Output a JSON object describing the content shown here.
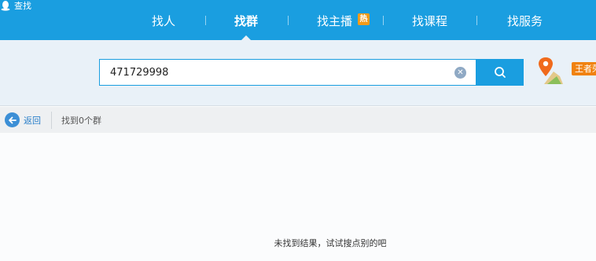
{
  "app": {
    "title": "查找"
  },
  "nav": {
    "items": [
      {
        "label": "找人"
      },
      {
        "label": "找群"
      },
      {
        "label": "找主播"
      },
      {
        "label": "找课程"
      },
      {
        "label": "找服务"
      }
    ],
    "active_index": 1,
    "hot_badge": "热"
  },
  "search": {
    "query": "471729998",
    "placeholder": ""
  },
  "promo": {
    "badge": "王者荣"
  },
  "toolbar": {
    "back_label": "返回",
    "result_text": "找到0个群"
  },
  "empty_state": {
    "message": "未找到结果，试试搜点别的吧"
  },
  "colors": {
    "accent": "#1a9ee0",
    "search_band": "#e9f1f8",
    "toolbar": "#eef0f2",
    "link": "#2a7fc9",
    "badge_orange": "#f59b19"
  },
  "icons": [
    "qq-penguin-icon",
    "hot-icon",
    "clear-icon",
    "search-icon",
    "map-pin-icon",
    "back-arrow-icon"
  ]
}
